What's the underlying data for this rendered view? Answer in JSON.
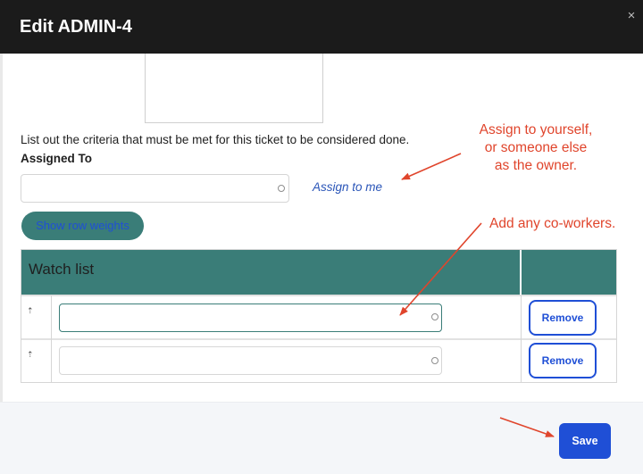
{
  "dialog": {
    "title": "Edit ADMIN-4",
    "close_glyph": "×"
  },
  "form": {
    "criteria_help": "List out the criteria that must be met for this ticket to be considered done.",
    "assigned_label": "Assigned To",
    "assignee_value": "",
    "assign_me_label": "Assign to me",
    "show_weights_label": "Show row weights"
  },
  "watch_list": {
    "header": "Watch list",
    "rows": [
      {
        "handle": "⇡",
        "value": "",
        "remove_label": "Remove",
        "focused": true
      },
      {
        "handle": "⇡",
        "value": "",
        "remove_label": "Remove",
        "focused": false
      }
    ]
  },
  "footer": {
    "save_label": "Save"
  },
  "annotations": {
    "assign_lines": [
      "Assign to yourself,",
      "or someone else",
      "as the owner."
    ],
    "coworkers": "Add any co-workers.",
    "color": "#e0452c"
  },
  "colors": {
    "titlebar": "#1b1b1b",
    "accent_teal": "#3a7d78",
    "primary_blue": "#1f4fd6",
    "link_blue": "#2a55b8"
  },
  "icons": {
    "close": "close-icon",
    "input_status": "circle-icon",
    "drag": "drag-handle-icon"
  }
}
